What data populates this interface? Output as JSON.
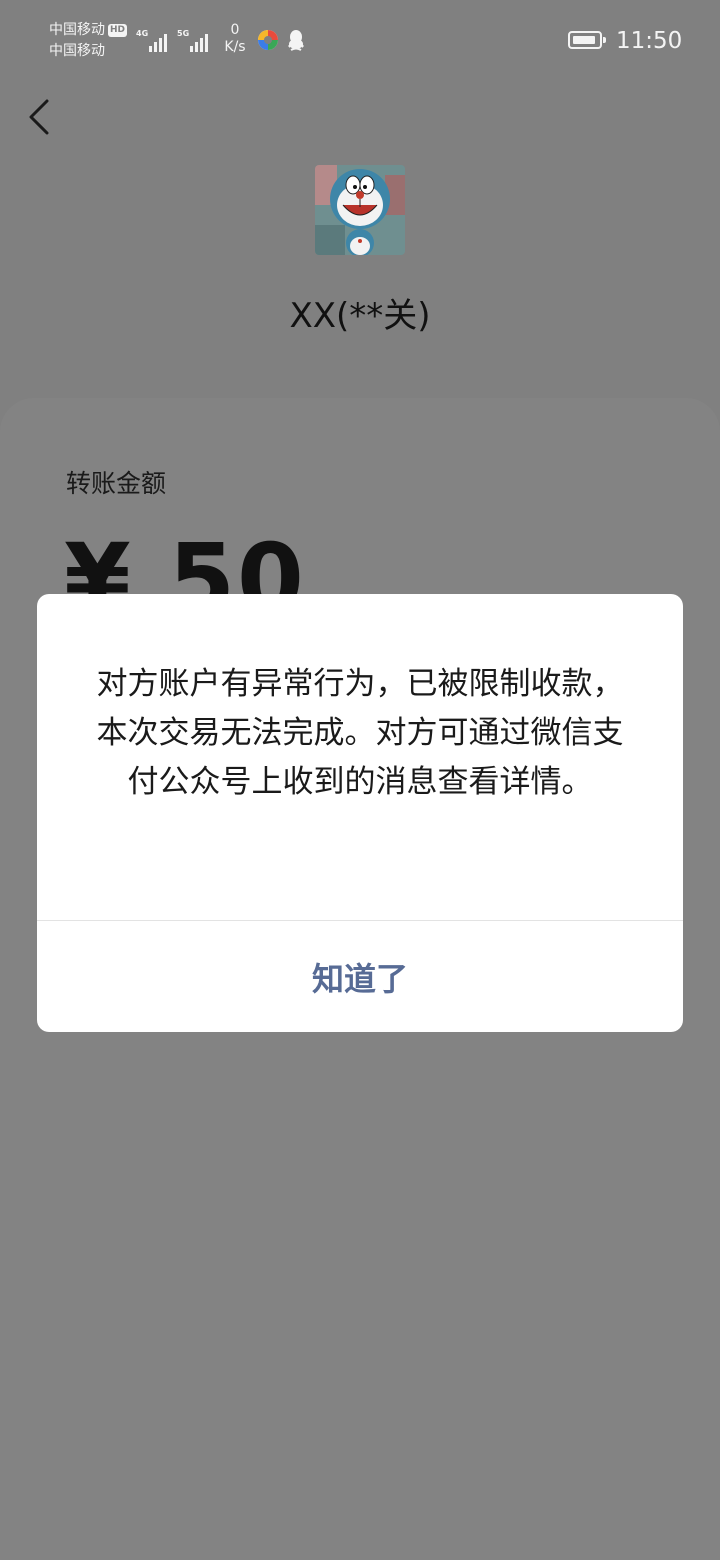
{
  "status_bar": {
    "carrier_1": "中国移动",
    "hd_badge": "HD",
    "carrier_2": "中国移动",
    "signal_1_label": "4G",
    "signal_2_label": "5G",
    "net_speed_value": "0",
    "net_speed_unit": "K/s",
    "time": "11:50",
    "icons": [
      "signal-icon",
      "signal-icon",
      "colorful-app-icon",
      "qq-icon",
      "battery-icon"
    ]
  },
  "header": {
    "back_icon": "chevron-left-icon",
    "payee_name": "XX(**关)"
  },
  "transfer": {
    "amount_label": "转账金额",
    "amount": "¥ 50"
  },
  "dialog": {
    "message": "对方账户有异常行为，已被限制收款，本次交易无法完成。对方可通过微信支付公众号上收到的消息查看详情。",
    "confirm_label": "知道了"
  },
  "colors": {
    "overlay_background": "#808080",
    "dialog_background": "#ffffff",
    "confirm_text": "#576b95"
  }
}
